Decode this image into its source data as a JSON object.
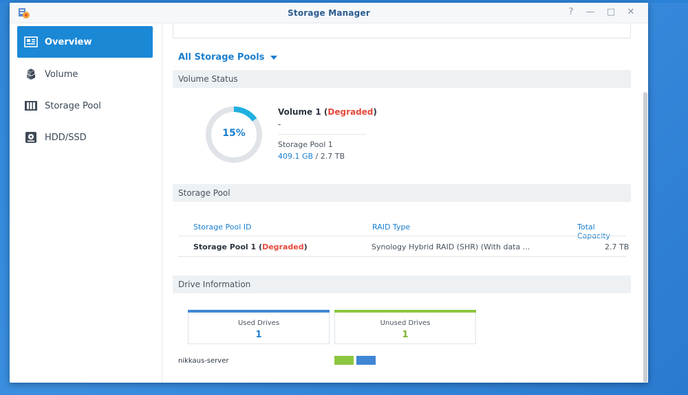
{
  "window": {
    "title": "Storage Manager"
  },
  "window_controls": {
    "help": "?",
    "minimize": "—",
    "maximize": "□",
    "close": "✕"
  },
  "sidebar": {
    "items": [
      {
        "label": "Overview",
        "icon": "overview-icon",
        "active": true
      },
      {
        "label": "Volume",
        "icon": "volume-icon",
        "active": false
      },
      {
        "label": "Storage Pool",
        "icon": "storage-pool-icon",
        "active": false
      },
      {
        "label": "HDD/SSD",
        "icon": "hdd-icon",
        "active": false
      }
    ]
  },
  "main": {
    "pool_filter": "All Storage Pools",
    "volume_status": {
      "heading": "Volume Status",
      "usage_percent_label": "15%",
      "usage_fraction": 0.15,
      "volume_name": "Volume 1",
      "status": "Degraded",
      "description": "-",
      "pool": "Storage Pool 1",
      "used": "409.1 GB",
      "total": "2.7 TB"
    },
    "storage_pool": {
      "heading": "Storage Pool",
      "columns": [
        "Storage Pool ID",
        "RAID Type",
        "Total Capacity"
      ],
      "rows": [
        {
          "id": "Storage Pool 1",
          "status": "Degraded",
          "raid": "Synology Hybrid RAID (SHR) (With data ...",
          "capacity": "2.7 TB"
        }
      ]
    },
    "drive_information": {
      "heading": "Drive Information",
      "used_label": "Used Drives",
      "used_count": "1",
      "unused_label": "Unused Drives",
      "unused_count": "1",
      "server_name": "nikkaus-server"
    }
  },
  "colors": {
    "accent": "#1b88d6",
    "degraded": "#e5483b",
    "used_drive": "#3f86d4",
    "unused_drive": "#8cc63f",
    "donut_track": "#e0e3e7"
  }
}
